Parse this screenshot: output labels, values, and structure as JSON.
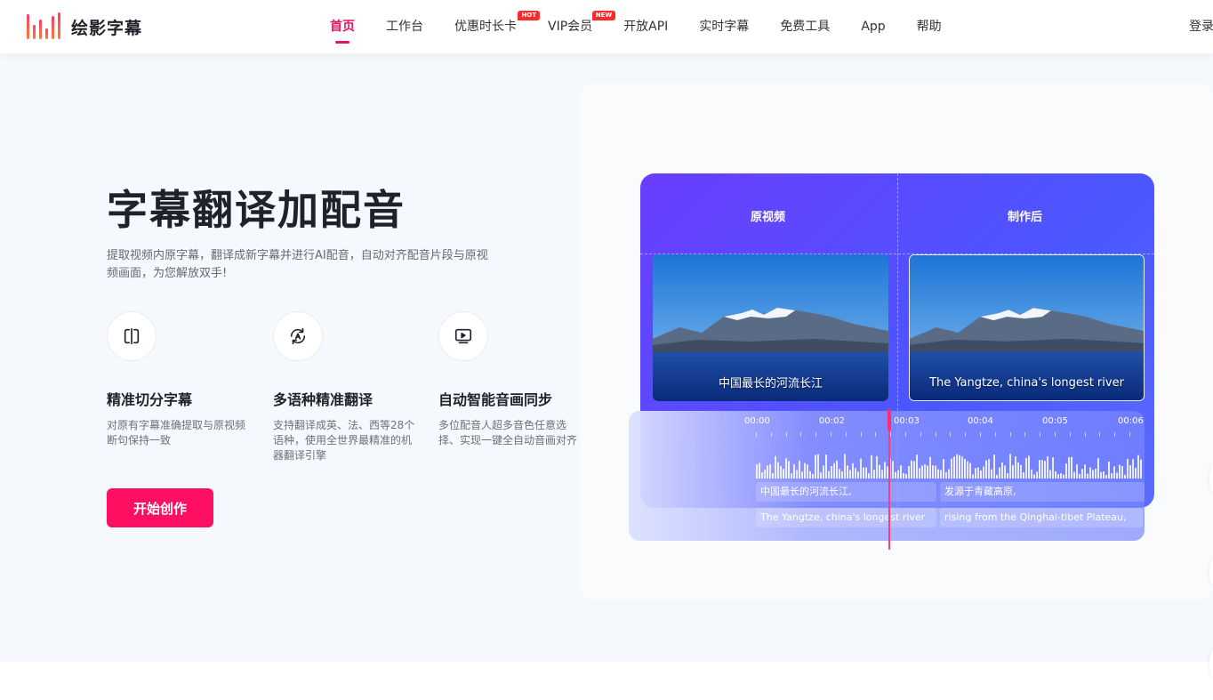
{
  "brand": {
    "name": "绘影字幕"
  },
  "nav": {
    "items": [
      {
        "label": "首页",
        "active": true
      },
      {
        "label": "工作台"
      },
      {
        "label": "优惠时长卡",
        "badge": "HOT"
      },
      {
        "label": "VIP会员",
        "badge": "NEW"
      },
      {
        "label": "开放API"
      },
      {
        "label": "实时字幕"
      },
      {
        "label": "免费工具"
      },
      {
        "label": "App"
      },
      {
        "label": "帮助"
      }
    ],
    "login": "登录"
  },
  "hero": {
    "title": "字幕翻译加配音",
    "description": "提取视频内原字幕，翻译成新字幕并进行AI配音，自动对齐配音片段与原视频画面，为您解放双手!",
    "features": [
      {
        "icon": "split-icon",
        "title": "精准切分字幕",
        "desc": "对原有字幕准确提取与原视频断句保持一致"
      },
      {
        "icon": "translate-icon",
        "title": "多语种精准翻译",
        "desc": "支持翻译成英、法、西等28个语种，使用全世界最精准的机器翻译引擎"
      },
      {
        "icon": "play-screen-icon",
        "title": "自动智能音画同步",
        "desc": "多位配音人超多音色任意选择、实现一键全自动音画对齐"
      }
    ],
    "cta": "开始创作"
  },
  "demo": {
    "original_label": "原视频",
    "result_label": "制作后",
    "original_caption": "中国最长的河流长江",
    "result_caption": "The Yangtze, china's longest river",
    "timeline": {
      "ticks": [
        "00:00",
        "00:02",
        "00:03",
        "00:04",
        "00:05",
        "00:06"
      ],
      "subs_cn": [
        "中国最长的河流长江,",
        "发源于青藏高原,"
      ],
      "subs_en": [
        "The Yangtze, china's longest river",
        "rising from the Qinghai-tibet Plateau,"
      ]
    }
  },
  "colors": {
    "accent": "#ff0f62",
    "nav_active": "#e9135c",
    "demo_gradient_start": "#6a3dff",
    "demo_gradient_end": "#4b57ff"
  }
}
